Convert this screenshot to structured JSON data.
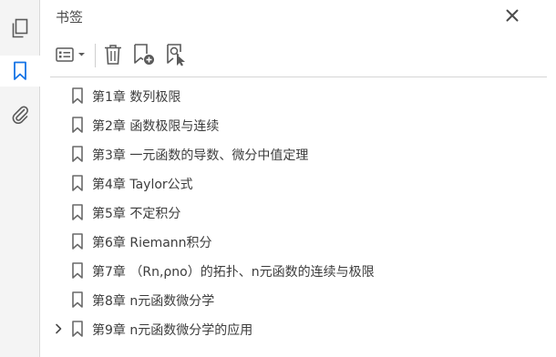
{
  "rail": {
    "items": [
      {
        "name": "pages-thumbnails",
        "icon": "pages-icon"
      },
      {
        "name": "bookmarks",
        "icon": "bookmark-icon",
        "active": true
      },
      {
        "name": "attachments",
        "icon": "paperclip-icon"
      }
    ],
    "accent": "#1473e6"
  },
  "panel": {
    "title": "书签",
    "close_icon": "close-icon"
  },
  "toolbar": {
    "items": [
      {
        "name": "options-menu",
        "icon": "list-options-icon"
      },
      {
        "name": "delete-bookmark",
        "icon": "trash-icon"
      },
      {
        "name": "new-bookmark",
        "icon": "bookmark-add-icon"
      },
      {
        "name": "new-bookmark-from-structure",
        "icon": "bookmark-search-icon"
      }
    ]
  },
  "bookmarks": [
    {
      "label": "第1章  数列极限",
      "expandable": false
    },
    {
      "label": "第2章  函数极限与连续",
      "expandable": false
    },
    {
      "label": "第3章  一元函数的导数、微分中值定理",
      "expandable": false
    },
    {
      "label": "第4章  Taylor公式",
      "expandable": false
    },
    {
      "label": "第5章  不定积分",
      "expandable": false
    },
    {
      "label": "第6章  Riemann积分",
      "expandable": false
    },
    {
      "label": "第7章  （Rn,ρno）的拓扑、n元函数的连续与极限",
      "expandable": false
    },
    {
      "label": "第8章  n元函数微分学",
      "expandable": false
    },
    {
      "label": "第9章  n元函数微分学的应用",
      "expandable": true
    }
  ]
}
